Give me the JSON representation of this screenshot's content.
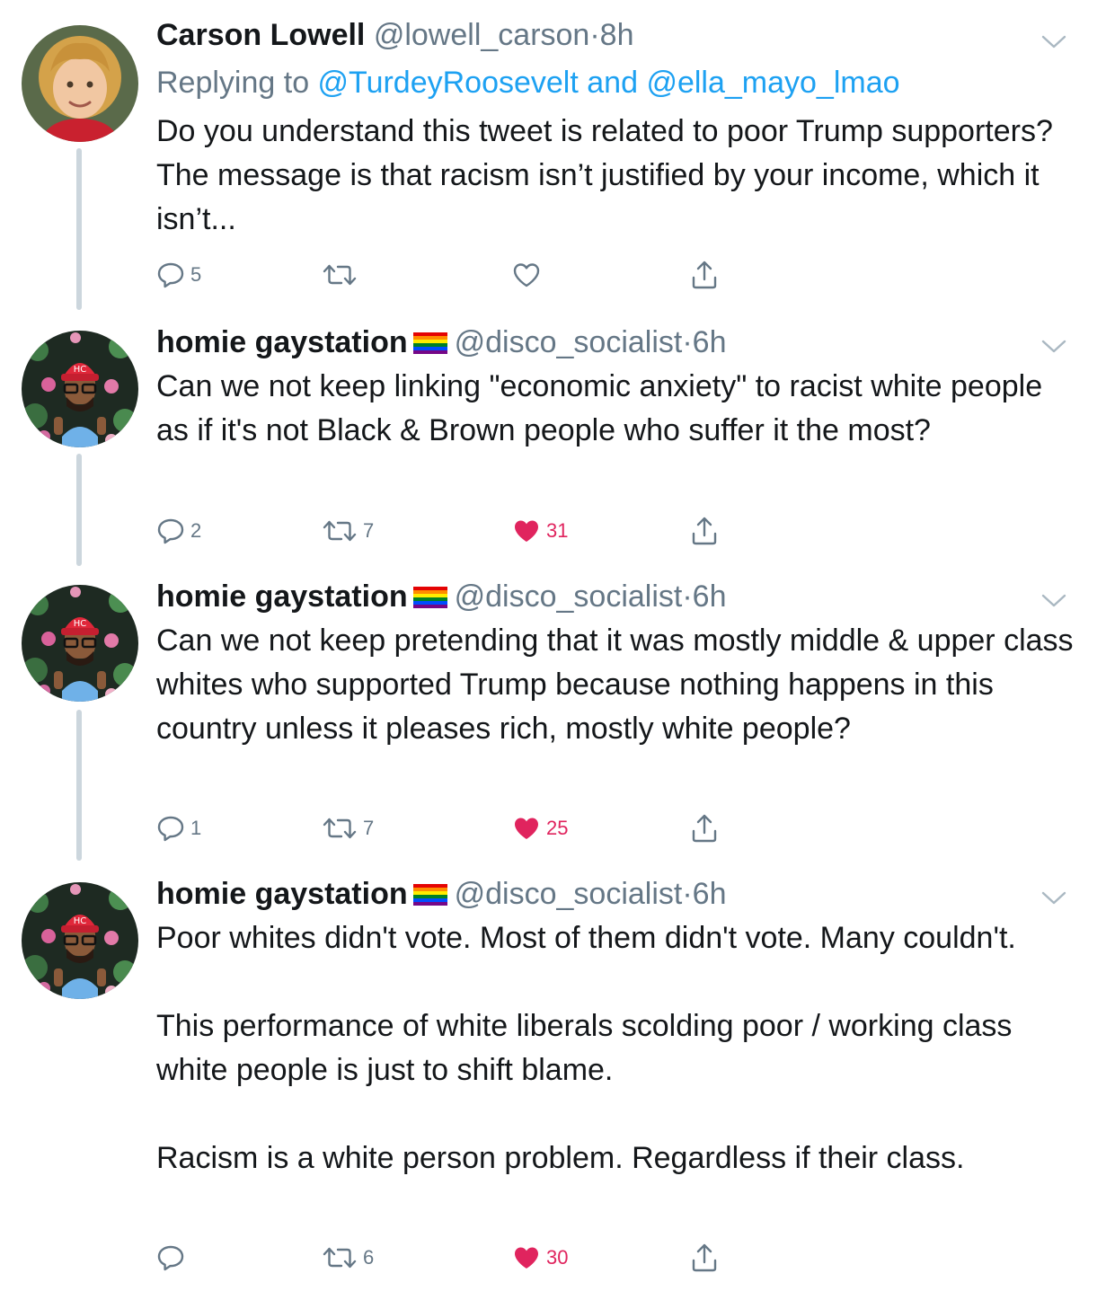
{
  "tweets": [
    {
      "name": "Carson Lowell",
      "handle": "@lowell_carson",
      "time": "8h",
      "has_flag": false,
      "reply_prefix": "Replying to ",
      "reply_user1": "@TurdeyRoosevelt",
      "reply_and": " and ",
      "reply_user2": "@ella_mayo_lmao",
      "text": "Do you understand this tweet is related to poor Trump supporters? The message is that racism isn’t justified by your income, which it isn’t...",
      "replies": "5",
      "retweets": "",
      "likes": "",
      "liked": false
    },
    {
      "name": "homie gaystation",
      "handle": "@disco_socialist",
      "time": "6h",
      "has_flag": true,
      "text": "Can we not keep linking \"economic anxiety\" to racist white people as if it's not Black & Brown people who suffer it the most?",
      "replies": "2",
      "retweets": "7",
      "likes": "31",
      "liked": true
    },
    {
      "name": "homie gaystation",
      "handle": "@disco_socialist",
      "time": "6h",
      "has_flag": true,
      "text": "Can we not keep pretending that it was mostly middle & upper class whites who supported Trump because nothing happens in this country unless it pleases rich, mostly white people?",
      "replies": "1",
      "retweets": "7",
      "likes": "25",
      "liked": true
    },
    {
      "name": "homie gaystation",
      "handle": "@disco_socialist",
      "time": "6h",
      "has_flag": true,
      "text": "Poor whites didn't vote. Most of them didn't vote. Many couldn't.\n\nThis performance of white liberals scolding poor / working class white people is just to shift blame.\n\nRacism is a white person problem. Regardless if their class.",
      "replies": "",
      "retweets": "6",
      "likes": "30",
      "liked": true
    }
  ],
  "separator": "·",
  "colors": {
    "link": "#1da1f2",
    "muted": "#657786",
    "like": "#e0245e",
    "thread": "#ccd6dd"
  },
  "icons": [
    "reply-icon",
    "retweet-icon",
    "like-icon",
    "share-icon",
    "chevron-down-icon",
    "rainbow-flag-icon"
  ]
}
